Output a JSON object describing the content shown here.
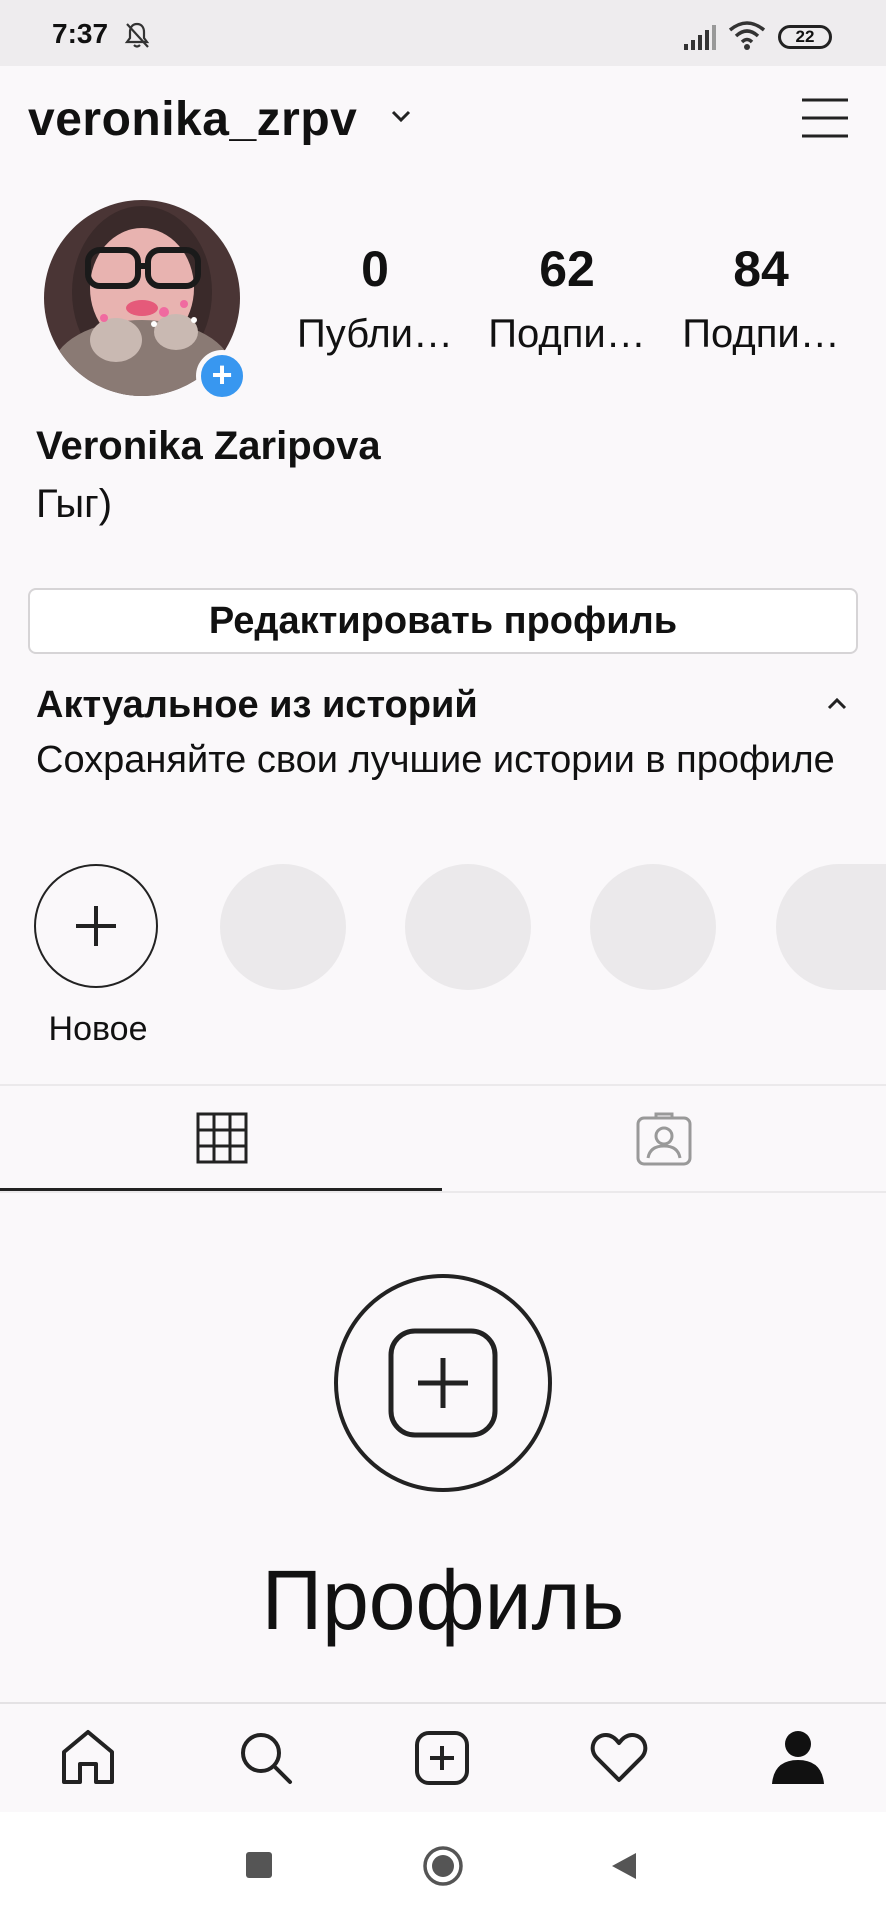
{
  "status_bar": {
    "time": "7:37",
    "battery": "22"
  },
  "header": {
    "username": "veronika_zrpv"
  },
  "profile": {
    "stats": [
      {
        "value": "0",
        "label": "Публи…"
      },
      {
        "value": "62",
        "label": "Подпи…"
      },
      {
        "value": "84",
        "label": "Подпи…"
      }
    ],
    "full_name": "Veronika Zaripova",
    "bio": "Гыг)",
    "edit_button": "Редактировать профиль"
  },
  "highlights": {
    "title": "Актуальное из историй",
    "description": "Сохраняйте свои лучшие истории в профиле",
    "new_label": "Новое"
  },
  "empty_state": {
    "title": "Профиль"
  },
  "icons": {
    "menu": "hamburger-menu-icon",
    "grid": "grid-icon",
    "tagged": "tagged-person-icon",
    "home": "home-icon",
    "search": "search-icon",
    "add": "add-post-icon",
    "activity": "heart-icon",
    "profile": "profile-icon"
  },
  "colors": {
    "accent": "#3897f0",
    "background": "#faf8fa"
  }
}
